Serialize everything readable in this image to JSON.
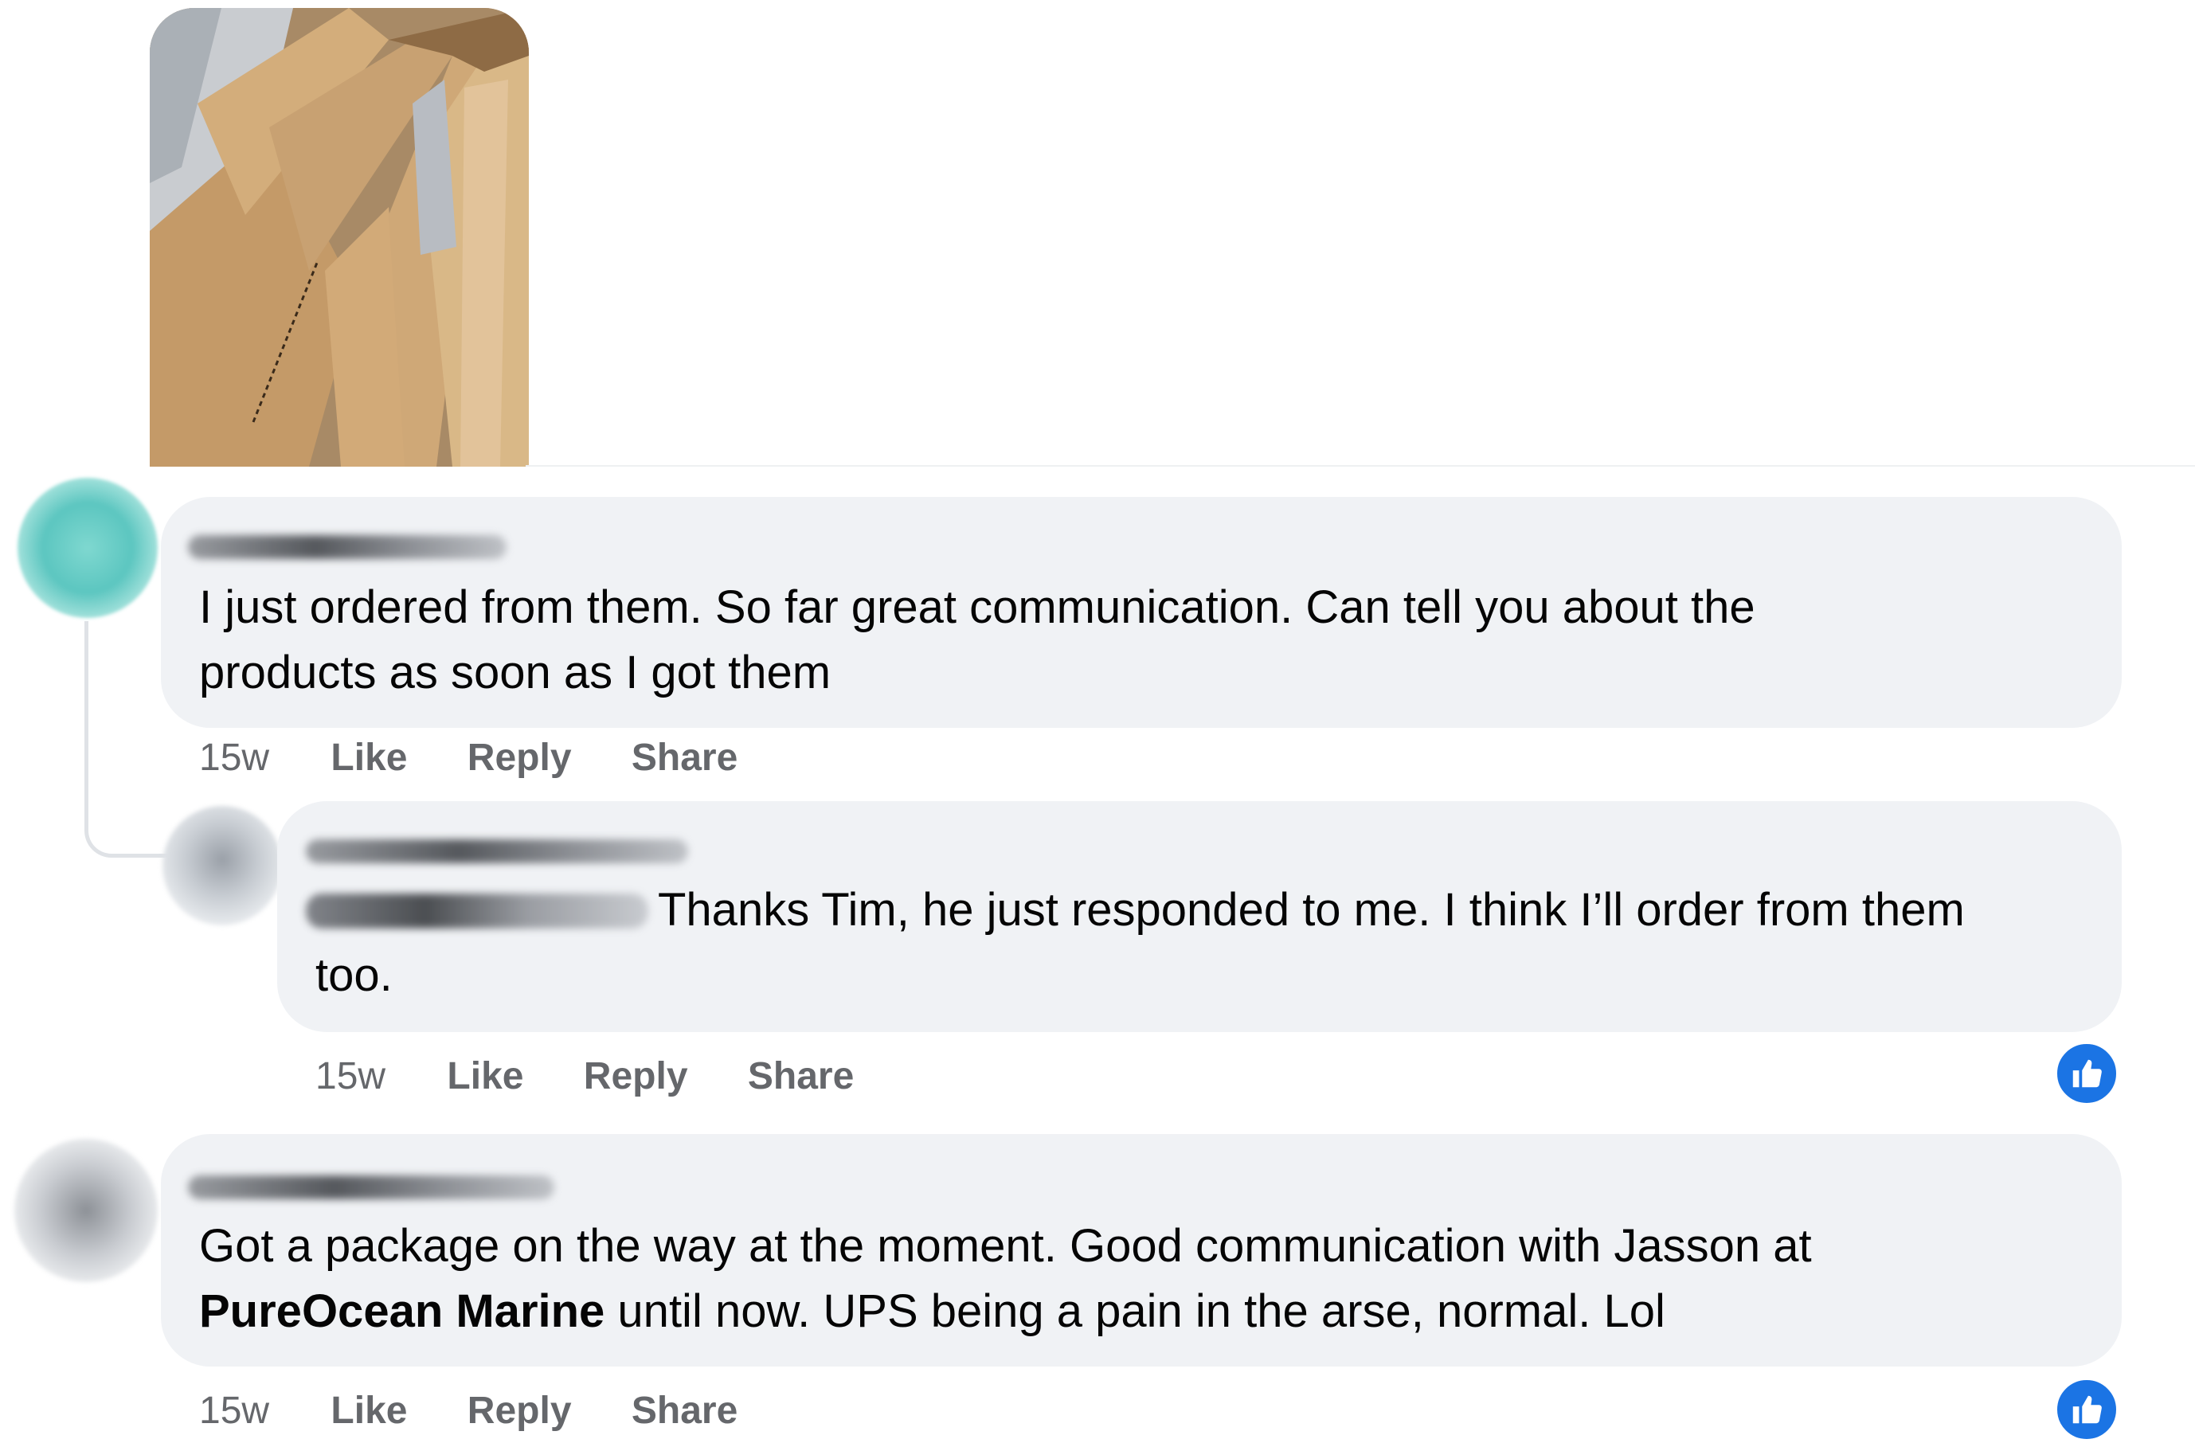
{
  "post_image": {
    "alt_icon": "photo-cardboard-boxes"
  },
  "comments": [
    {
      "text_line1": "I just ordered from them. So far great communication. Can tell you about the",
      "text_line2": "products as soon as I got them",
      "time": "15w",
      "like": "Like",
      "reply": "Reply",
      "share": "Share"
    },
    {
      "text_line1": "Thanks Tim, he just responded to me. I think I’ll order from them",
      "text_line2": "too.",
      "time": "15w",
      "like": "Like",
      "reply": "Reply",
      "share": "Share",
      "reaction_icon": "like-thumb-icon"
    },
    {
      "text_line1": "Got a package on the way at the moment. Good communication with Jasson at",
      "mention": "PureOcean Marine",
      "text_line2_rest": " until now. UPS being a pain in the arse, normal. Lol",
      "time": "15w",
      "like": "Like",
      "reply": "Reply",
      "share": "Share",
      "reaction_icon": "like-thumb-icon"
    }
  ],
  "colors": {
    "bubble": "#f0f2f5",
    "meta": "#65676b",
    "like_blue": "#1b74e4"
  }
}
